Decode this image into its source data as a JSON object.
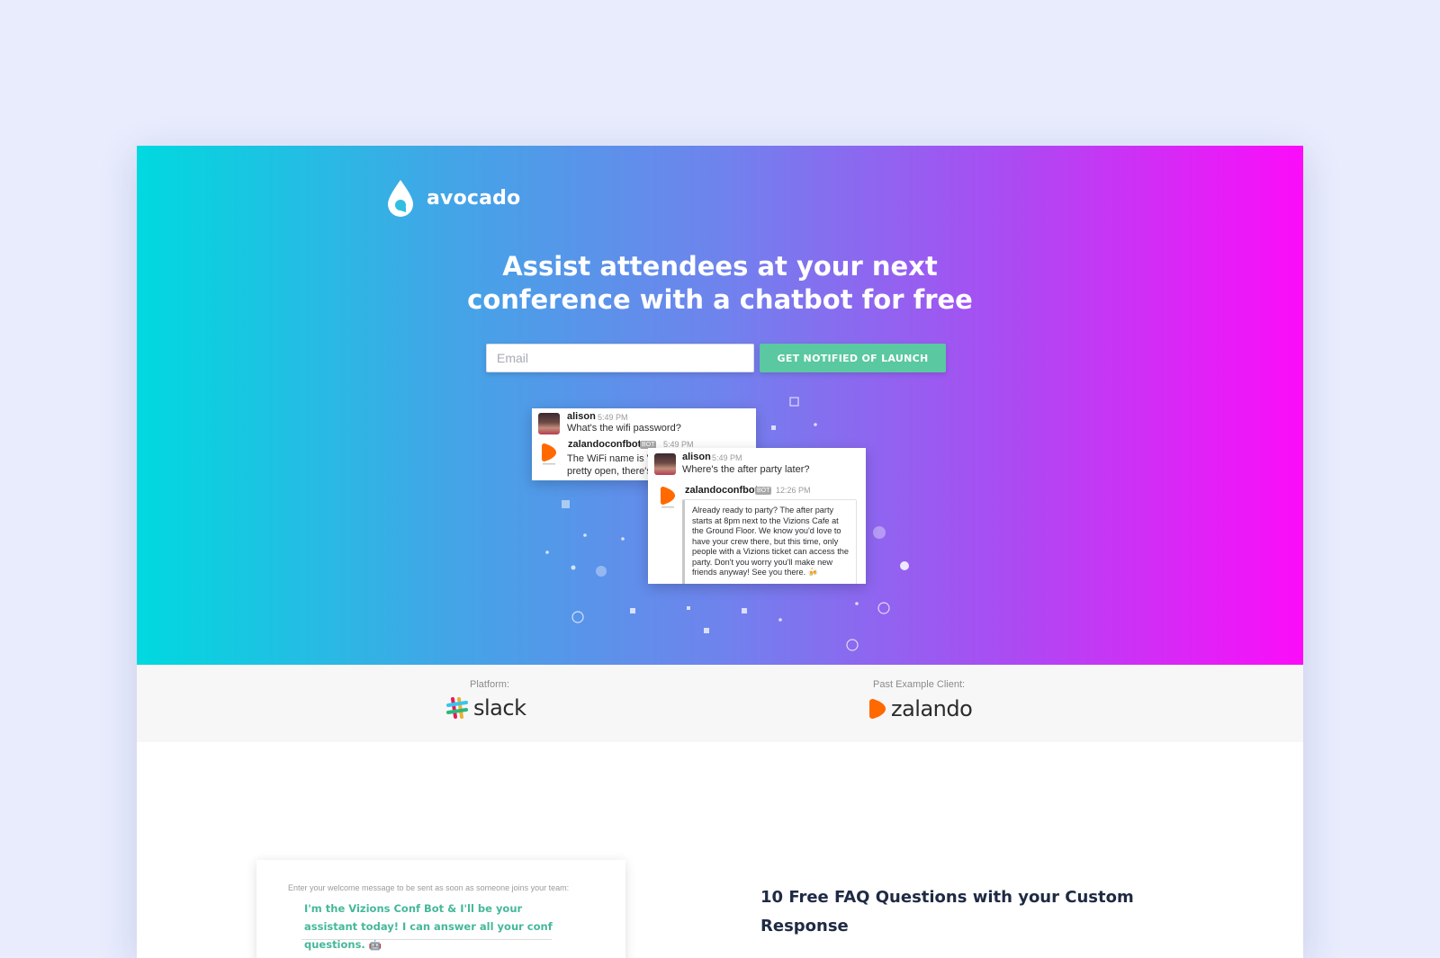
{
  "brand": {
    "name": "avocado",
    "logo_icon": "avocado-logo-icon"
  },
  "hero": {
    "headline": "Assist attendees at your next conference with a chatbot for free",
    "gradient": [
      "#00d9df",
      "#fc0cf9"
    ]
  },
  "signup": {
    "email_placeholder": "Email",
    "email_value": "",
    "button_label": "GET NOTIFIED OF LAUNCH",
    "button_color": "#5ac8a0"
  },
  "chat_preview": {
    "card1": {
      "user": {
        "name": "alison",
        "time": "5:49 PM",
        "text": "What's the wifi password?"
      },
      "bot": {
        "name": "zalandoconfbot",
        "tag": "BOT",
        "time": "5:49 PM",
        "line1": "The WiFi name is V",
        "line2": "pretty open, there's"
      }
    },
    "card2": {
      "user": {
        "name": "alison",
        "time": "5:49 PM",
        "text": "Where's the after party later?"
      },
      "bot": {
        "name": "zalandoconfbot",
        "tag": "BOT",
        "time": "12:26 PM",
        "reply_lines": [
          "Already ready to party? The after party",
          "starts at 8pm next to the Vizions Cafe at",
          "the Ground Floor. We know you'd love to",
          "have your crew there, but this time, only",
          "people with a Vizions ticket can access the",
          "party. Don't you worry you'll make new",
          "friends anyway! See you there. 🍻"
        ]
      }
    }
  },
  "platforms": {
    "platform_label": "Platform:",
    "platform_name": "slack",
    "client_label": "Past Example Client:",
    "client_name": "zalando",
    "client_color": "#ff6900"
  },
  "welcome": {
    "label": "Enter your welcome message to be sent as soon as someone joins your team:",
    "message": "I'm the Vizions Conf Bot & I'll be your assistant today! I can answer all your conf questions. 🤖"
  },
  "features": {
    "faq_title": "10 Free FAQ Questions with your Custom Response"
  }
}
